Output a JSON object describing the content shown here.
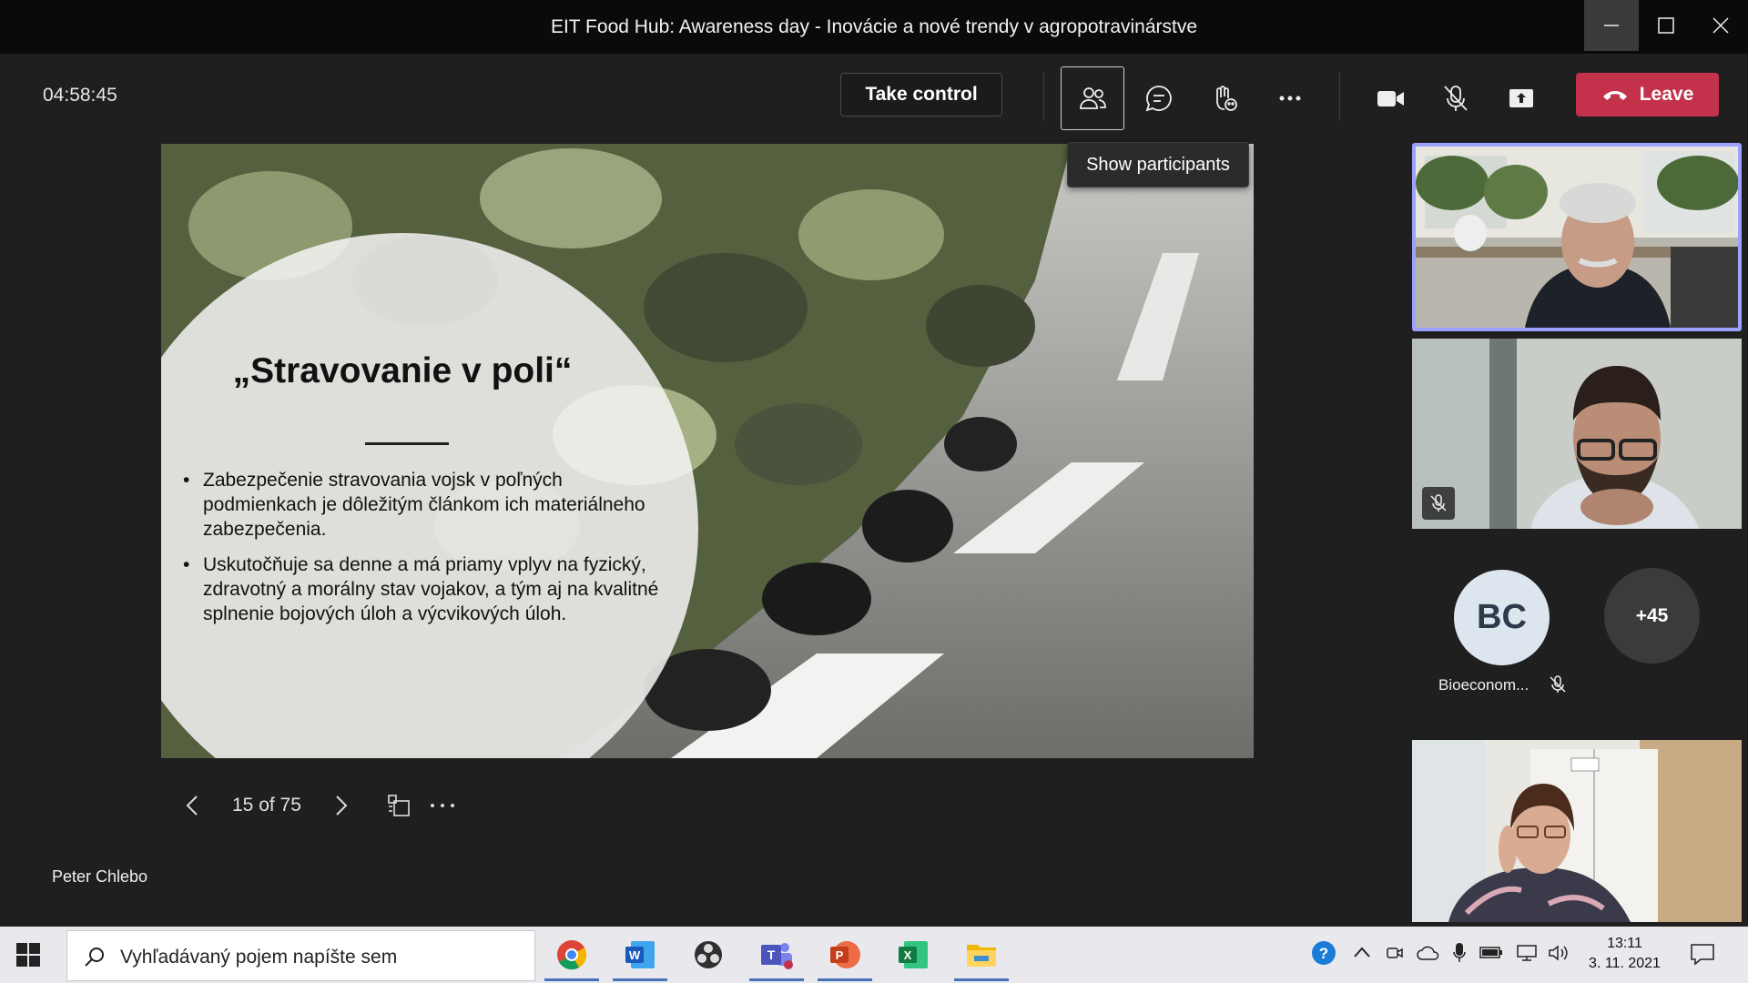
{
  "window": {
    "title": "EIT Food Hub: Awareness day - Inovácie a nové trendy v agropotravinárstve",
    "minimize_icon": "minimize-icon",
    "maximize_icon": "maximize-icon",
    "close_icon": "close-icon"
  },
  "toolbar": {
    "timer": "04:58:45",
    "take_control_label": "Take control",
    "leave_label": "Leave",
    "tooltip": "Show participants",
    "icons": [
      "participants-icon",
      "chat-icon",
      "reactions-icon",
      "more-icon",
      "camera-icon",
      "mic-off-icon",
      "share-icon",
      "phone-icon"
    ]
  },
  "slide": {
    "heading": "„Stravovanie v poli“",
    "bullets": [
      "Zabezpečenie stravovania vojsk v poľných podmienkach je dôležitým článkom ich materiálneho zabezpečenia.",
      "Uskutočňuje sa denne a má priamy vplyv na fyzický, zdravotný a morálny stav vojakov, a tým aj na kvalitné splnenie bojových úloh a výcvikových úloh."
    ]
  },
  "slide_nav": {
    "page": "15 of 75"
  },
  "presenter_name": "Peter Chlebo",
  "participants": {
    "bc_initials": "BC",
    "bc_name": "Bioeconom...",
    "more_count": "+45"
  },
  "taskbar": {
    "search_placeholder": "Vyhľadávaný pojem napíšte sem",
    "apps": [
      "chrome-icon",
      "word-icon",
      "obs-icon",
      "teams-icon",
      "powerpoint-icon",
      "excel-icon",
      "file-explorer-icon"
    ],
    "time": "13:11",
    "date": "3. 11. 2021"
  },
  "colors": {
    "leave": "#c4314b",
    "active_speaker_border": "#9ea2ff",
    "taskbar": "#e9e9ed"
  }
}
